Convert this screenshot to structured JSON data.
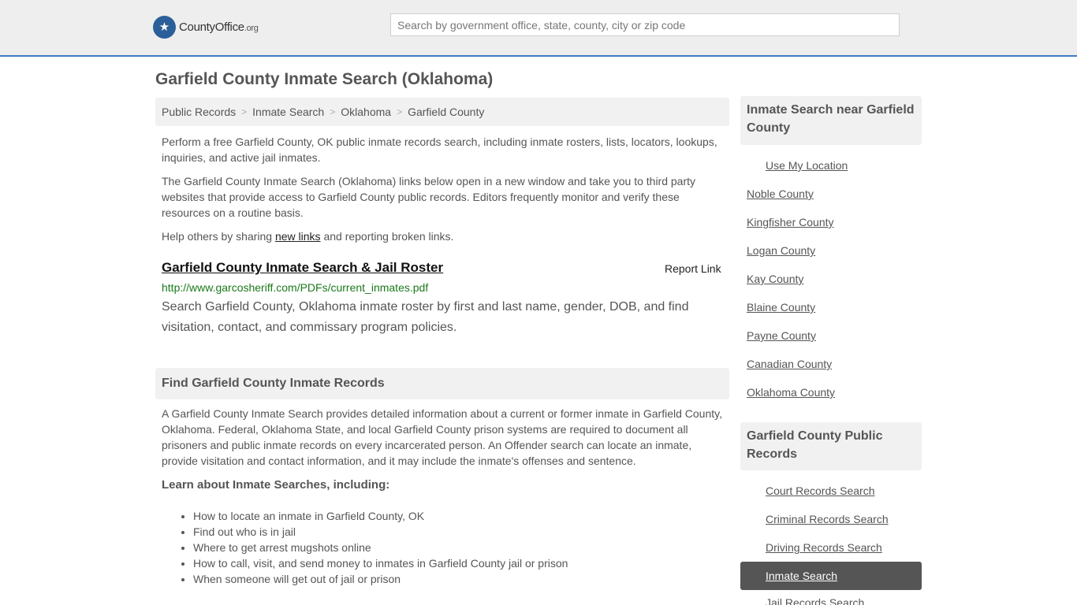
{
  "header": {
    "logo_text": "CountyOffice",
    "logo_suffix": ".org",
    "search_placeholder": "Search by government office, state, county, city or zip code"
  },
  "page_title": "Garfield County Inmate Search (Oklahoma)",
  "breadcrumb": [
    "Public Records",
    "Inmate Search",
    "Oklahoma",
    "Garfield County"
  ],
  "intro": {
    "p1": "Perform a free Garfield County, OK public inmate records search, including inmate rosters, lists, locators, lookups, inquiries, and active jail inmates.",
    "p2": "The Garfield County Inmate Search (Oklahoma) links below open in a new window and take you to third party websites that provide access to Garfield County public records. Editors frequently monitor and verify these resources on a routine basis.",
    "p3_before": "Help others by sharing ",
    "p3_link": "new links",
    "p3_after": " and reporting broken links."
  },
  "result": {
    "title": "Garfield County Inmate Search & Jail Roster",
    "report": "Report Link",
    "url": "http://www.garcosheriff.com/PDFs/current_inmates.pdf",
    "description": "Search Garfield County, Oklahoma inmate roster by first and last name, gender, DOB, and find visitation, contact, and commissary program policies."
  },
  "find_section": {
    "title": "Find Garfield County Inmate Records",
    "body": "A Garfield County Inmate Search provides detailed information about a current or former inmate in Garfield County, Oklahoma. Federal, Oklahoma State, and local Garfield County prison systems are required to document all prisoners and public inmate records on every incarcerated person. An Offender search can locate an inmate, provide visitation and contact information, and it may include the inmate's offenses and sentence.",
    "learn_title": "Learn about Inmate Searches, including:",
    "bullets": [
      "How to locate an inmate in Garfield County, OK",
      "Find out who is in jail",
      "Where to get arrest mugshots online",
      "How to call, visit, and send money to inmates in Garfield County jail or prison",
      "When someone will get out of jail or prison"
    ]
  },
  "sidebar": {
    "nearby_title": "Inmate Search near Garfield County",
    "use_location": "Use My Location",
    "counties": [
      "Noble County",
      "Kingfisher County",
      "Logan County",
      "Kay County",
      "Blaine County",
      "Payne County",
      "Canadian County",
      "Oklahoma County"
    ],
    "records_title": "Garfield County Public Records",
    "records": [
      "Court Records Search",
      "Criminal Records Search",
      "Driving Records Search",
      "Inmate Search",
      "Jail Records Search"
    ],
    "active_index": 3
  },
  "colors": {
    "accent": "#3d7dbf",
    "url_green": "#1a7a1a",
    "active_bg": "#555555"
  }
}
